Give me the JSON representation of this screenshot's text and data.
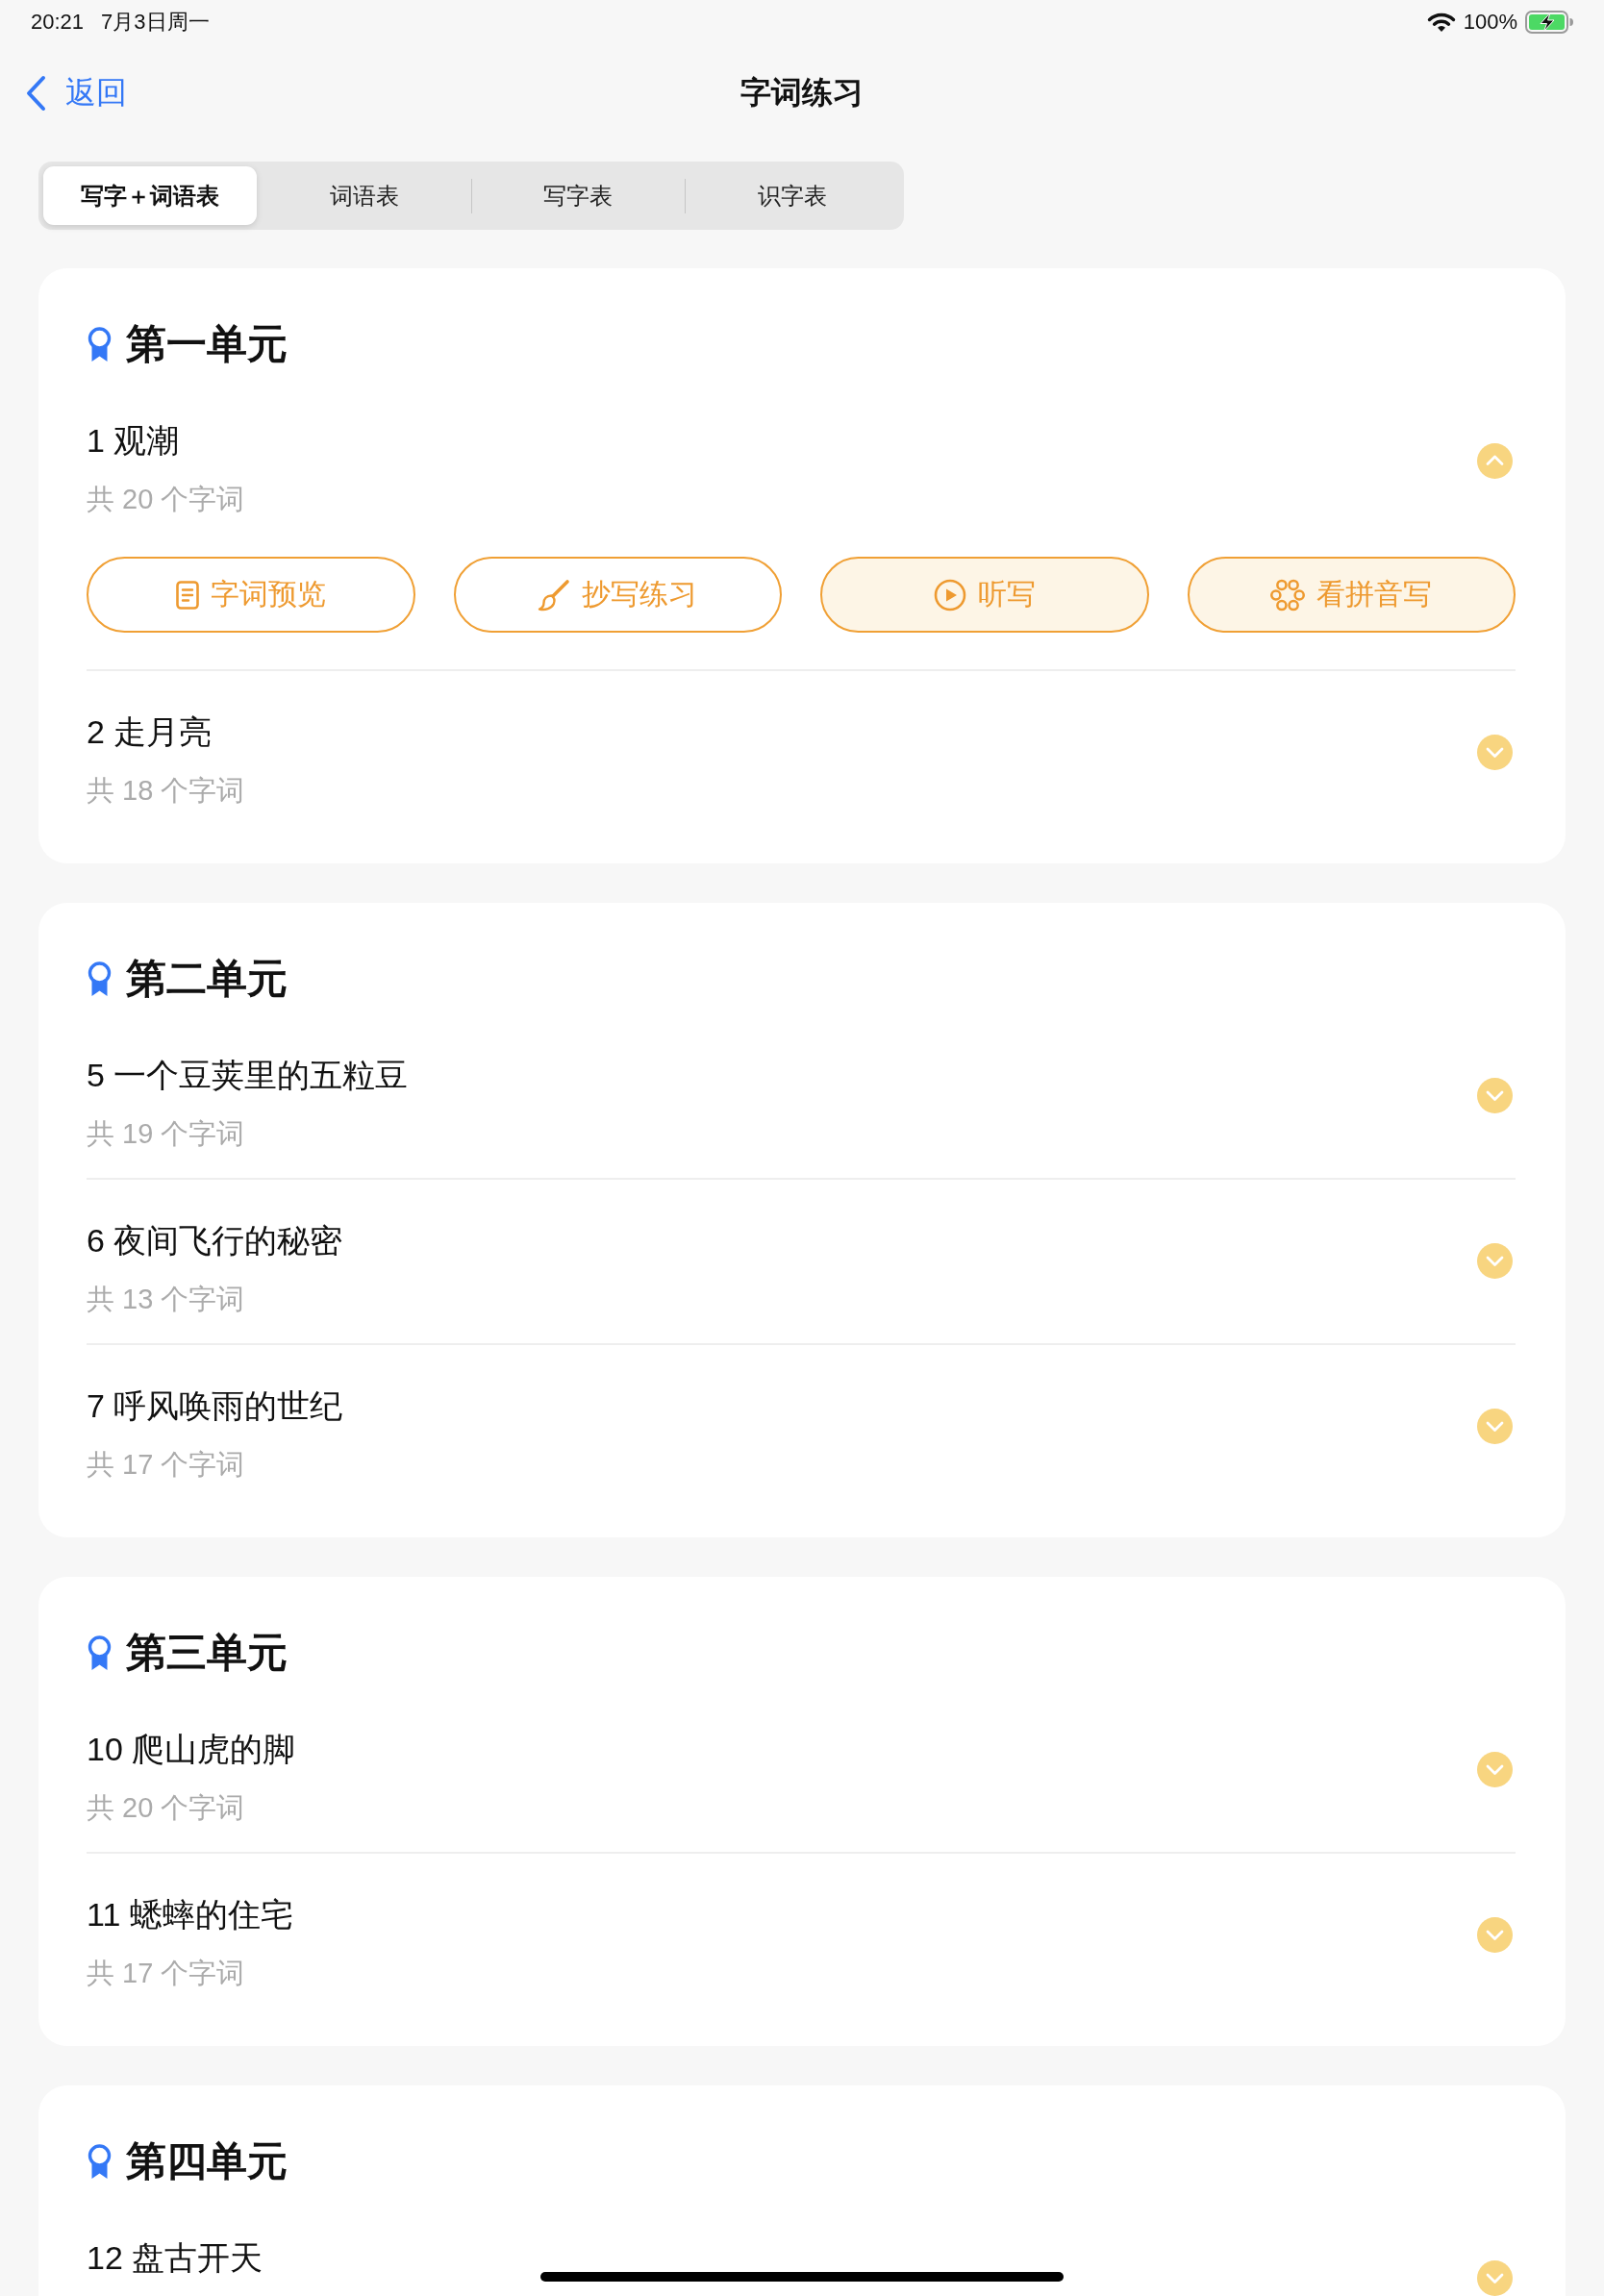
{
  "status_bar": {
    "time": "20:21",
    "date": "7月3日周一",
    "battery": "100%"
  },
  "nav": {
    "back": "返回",
    "title": "字词练习"
  },
  "tabs": [
    {
      "label": "写字＋词语表",
      "selected": true
    },
    {
      "label": "词语表",
      "selected": false
    },
    {
      "label": "写字表",
      "selected": false
    },
    {
      "label": "识字表",
      "selected": false
    }
  ],
  "units": [
    {
      "title": "第一单元",
      "lessons": [
        {
          "title": "1 观潮",
          "count": "共 20 个字词",
          "expanded": true,
          "actions": [
            {
              "kind": "preview",
              "label": "字词预览",
              "tinted": false
            },
            {
              "kind": "copy",
              "label": "抄写练习",
              "tinted": false
            },
            {
              "kind": "dictation",
              "label": "听写",
              "tinted": true
            },
            {
              "kind": "pinyin",
              "label": "看拼音写",
              "tinted": true
            }
          ]
        },
        {
          "title": "2 走月亮",
          "count": "共 18 个字词",
          "expanded": false
        }
      ]
    },
    {
      "title": "第二单元",
      "lessons": [
        {
          "title": "5 一个豆荚里的五粒豆",
          "count": "共 19 个字词",
          "expanded": false
        },
        {
          "title": "6 夜间飞行的秘密",
          "count": "共 13 个字词",
          "expanded": false
        },
        {
          "title": "7 呼风唤雨的世纪",
          "count": "共 17 个字词",
          "expanded": false
        }
      ]
    },
    {
      "title": "第三单元",
      "lessons": [
        {
          "title": "10 爬山虎的脚",
          "count": "共 20 个字词",
          "expanded": false
        },
        {
          "title": "11 蟋蟀的住宅",
          "count": "共 17 个字词",
          "expanded": false
        }
      ]
    },
    {
      "title": "第四单元",
      "lessons": [
        {
          "title": "12 盘古开天",
          "expanded": false
        }
      ]
    }
  ]
}
